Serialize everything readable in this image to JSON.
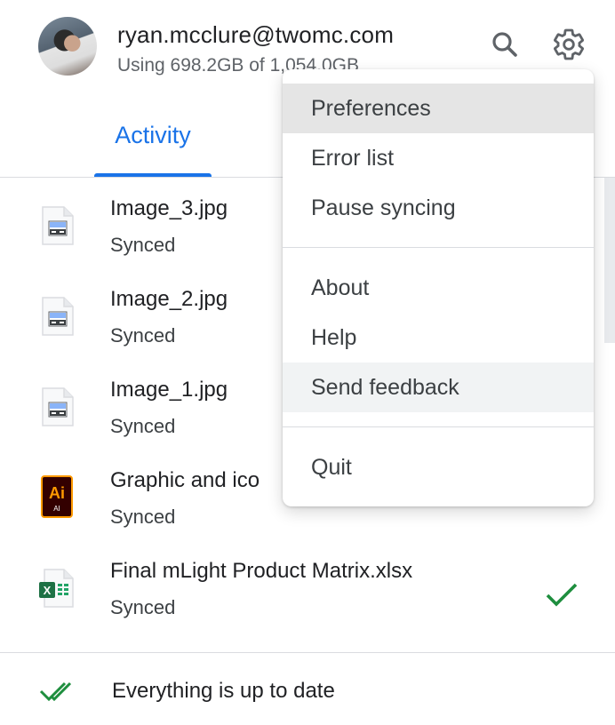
{
  "account": {
    "email": "ryan.mcclure@twomc.com",
    "usage": "Using 698.2GB of 1,054.0GB"
  },
  "header": {
    "search_icon": "search-icon",
    "settings_icon": "gear-icon"
  },
  "tabs": [
    {
      "label": "Activity",
      "active": true
    }
  ],
  "files": [
    {
      "name": "Image_3.jpg",
      "status": "Synced",
      "icon": "image-file-icon"
    },
    {
      "name": "Image_2.jpg",
      "status": "Synced",
      "icon": "image-file-icon"
    },
    {
      "name": "Image_1.jpg",
      "status": "Synced",
      "icon": "image-file-icon"
    },
    {
      "name": "Graphic and ico",
      "status": "Synced",
      "icon": "illustrator-file-icon"
    },
    {
      "name": "Final mLight Product Matrix.xlsx",
      "status": "Synced",
      "icon": "excel-file-icon",
      "checked": true
    }
  ],
  "menu": {
    "items": [
      {
        "label": "Preferences"
      },
      {
        "label": "Error list"
      },
      {
        "label": "Pause syncing"
      },
      {
        "label": "About"
      },
      {
        "label": "Help"
      },
      {
        "label": "Send feedback"
      },
      {
        "label": "Quit"
      }
    ]
  },
  "footer": {
    "status": "Everything is up to date"
  },
  "colors": {
    "accent": "#1a73e8",
    "success": "#1e8e3e",
    "text": "#202124",
    "muted": "#5f6368"
  }
}
